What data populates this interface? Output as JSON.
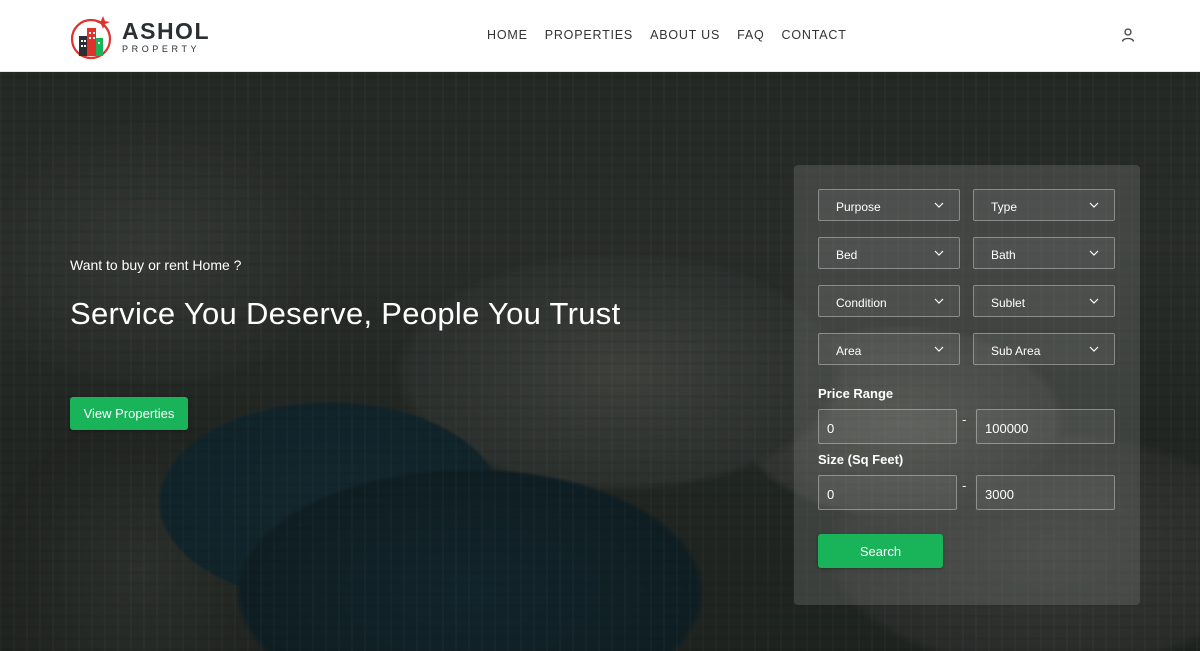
{
  "brand": {
    "name": "ASHOL",
    "sub": "PROPERTY",
    "accent": "#19b45a",
    "logo_red": "#e0322d"
  },
  "nav": {
    "items": [
      "HOME",
      "PROPERTIES",
      "ABOUT US",
      "FAQ",
      "CONTACT"
    ]
  },
  "hero": {
    "tagline": "Want to buy or rent Home ?",
    "headline": "Service You Deserve, People You Trust",
    "cta_label": "View Properties"
  },
  "search": {
    "filters": [
      "Purpose",
      "Type",
      "Bed",
      "Bath",
      "Condition",
      "Sublet",
      "Area",
      "Sub Area"
    ],
    "price_label": "Price Range",
    "price_min": "0",
    "price_max": "100000",
    "size_label": "Size (Sq Feet)",
    "size_min": "0",
    "size_max": "3000",
    "separator": "-",
    "button_label": "Search"
  }
}
